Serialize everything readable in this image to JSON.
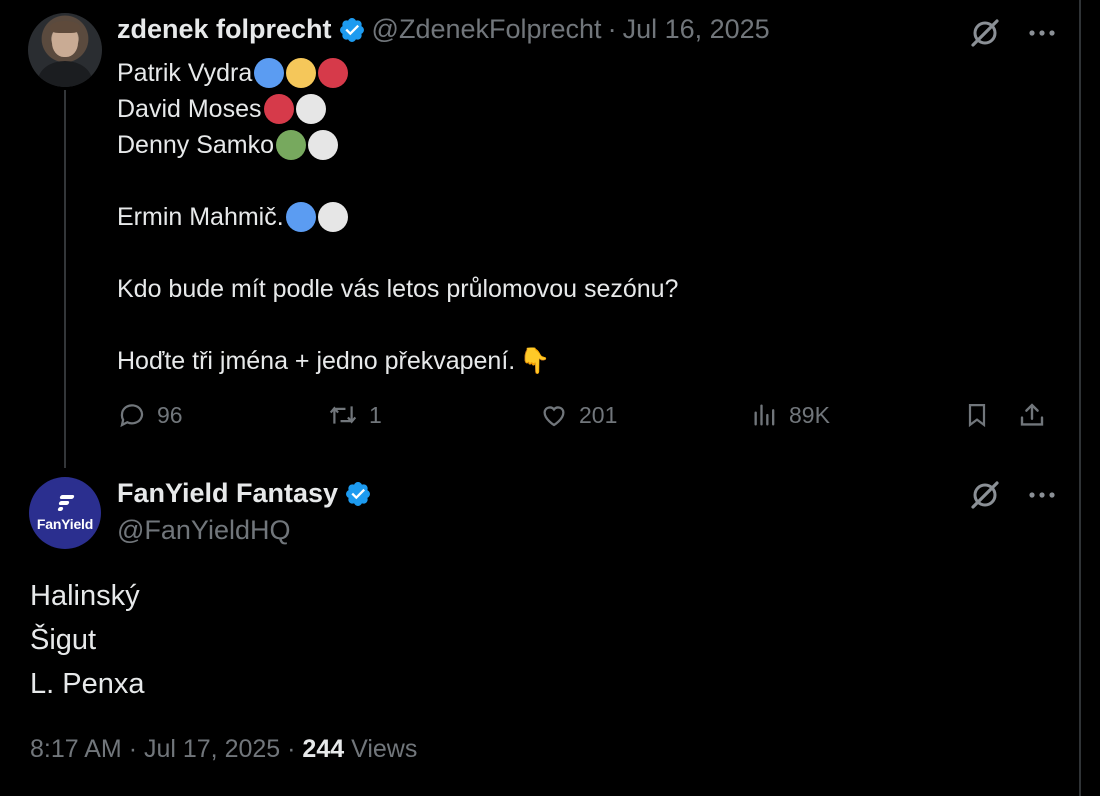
{
  "tweet": {
    "author_name": "zdenek folprecht",
    "handle": "@ZdenekFolprecht",
    "separator": "·",
    "date": "Jul 16, 2025",
    "lines": [
      {
        "text": "Patrik Vydra",
        "dots": [
          "#5b9cf2",
          "#f5c75a",
          "#d63a4a"
        ]
      },
      {
        "text": "David Moses",
        "dots": [
          "#d63a4a",
          "#e6e6e6"
        ]
      },
      {
        "text": "Denny Samko",
        "dots": [
          "#77a95e",
          "#e6e6e6"
        ]
      },
      {
        "text": "Ermin Mahmič.",
        "dots": [
          "#5b9cf2",
          "#e6e6e6"
        ]
      },
      {
        "text": "Kdo bude mít podle vás letos průlomovou sezónu?"
      },
      {
        "text": "Hoďte tři jména + jedno překvapení.",
        "emoji": "👇"
      }
    ],
    "stats": {
      "replies": "96",
      "reposts": "1",
      "likes": "201",
      "views": "89K"
    }
  },
  "reply": {
    "author_name": "FanYield Fantasy",
    "handle": "@FanYieldHQ",
    "avatar_text": "FanYield",
    "lines": [
      "Halinský",
      "Šigut",
      "L. Penxa"
    ],
    "footer": {
      "time": "8:17 AM",
      "separator": "·",
      "date": "Jul 17, 2025",
      "views_count": "244",
      "views_label": "Views"
    }
  },
  "colors": {
    "background": "#000000",
    "text": "#e7e9ea",
    "muted": "#71767b",
    "verified": "#1d9bf0",
    "avatar_bg": "#2b2f8f"
  },
  "icons": [
    "verified-badge-icon",
    "grok-icon",
    "more-icon",
    "reply-icon",
    "repost-icon",
    "like-icon",
    "views-icon",
    "bookmark-icon",
    "share-icon"
  ]
}
